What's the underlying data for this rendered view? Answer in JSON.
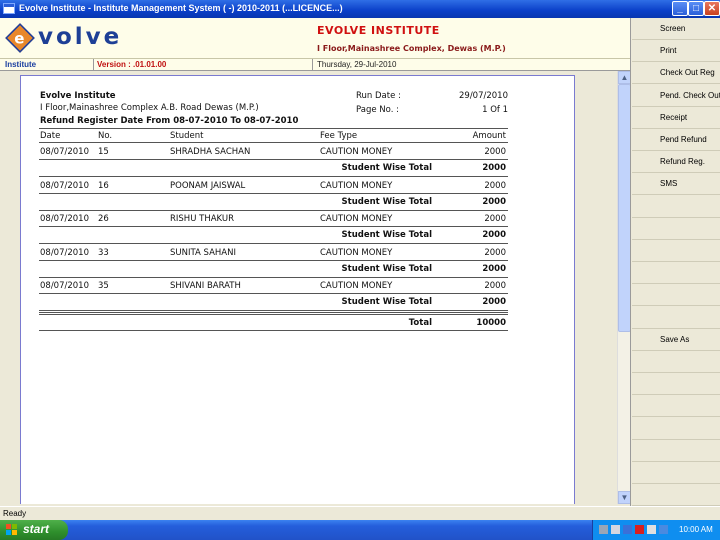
{
  "window": {
    "title": "Evolve Institute - Institute Management System ( -) 2010-2011 (...LICENCE...)",
    "buttons": [
      "_",
      "□",
      "✕"
    ]
  },
  "header": {
    "logo_letter": "e",
    "logo_word": "volve",
    "org_name": "EVOLVE INSTITUTE",
    "org_address": "I Floor,Mainashree Complex, Dewas (M.P.)"
  },
  "status_strip": {
    "module": "Institute",
    "version": "Version : .01.01.00",
    "date": "Thursday, 29-Jul-2010"
  },
  "sidebar": {
    "items": [
      "Screen",
      "Print",
      "Check Out Reg",
      "Pend. Check Out",
      "Receipt",
      "Pend Refund",
      "Refund Reg.",
      "SMS",
      "",
      "",
      "",
      "",
      "",
      "",
      "Save As",
      "",
      "",
      "",
      "",
      "",
      "",
      ""
    ]
  },
  "report": {
    "company": "Evolve Institute",
    "address": "I Floor,Mainashree Complex A.B. Road Dewas (M.P.)",
    "title": "Refund Register Date From 08-07-2010 To 08-07-2010",
    "run_date_label": "Run Date :",
    "run_date": "29/07/2010",
    "page_label": "Page No. :",
    "page": "1 Of 1",
    "columns": [
      "Date",
      "No.",
      "Student",
      "Fee Type",
      "Amount"
    ],
    "rows": [
      {
        "date": "08/07/2010",
        "no": "15",
        "student": "SHRADHA SACHAN",
        "fee": "CAUTION MONEY",
        "amount": "2000",
        "subtotal_label": "Student Wise Total",
        "subtotal": "2000"
      },
      {
        "date": "08/07/2010",
        "no": "16",
        "student": "POONAM JAISWAL",
        "fee": "CAUTION MONEY",
        "amount": "2000",
        "subtotal_label": "Student Wise Total",
        "subtotal": "2000"
      },
      {
        "date": "08/07/2010",
        "no": "26",
        "student": "RISHU  THAKUR",
        "fee": "CAUTION MONEY",
        "amount": "2000",
        "subtotal_label": "Student Wise Total",
        "subtotal": "2000"
      },
      {
        "date": "08/07/2010",
        "no": "33",
        "student": "SUNITA  SAHANI",
        "fee": "CAUTION MONEY",
        "amount": "2000",
        "subtotal_label": "Student Wise Total",
        "subtotal": "2000"
      },
      {
        "date": "08/07/2010",
        "no": "35",
        "student": "SHIVANI  BARATH",
        "fee": "CAUTION MONEY",
        "amount": "2000",
        "subtotal_label": "Student Wise Total",
        "subtotal": "2000"
      }
    ],
    "total_label": "Total",
    "total": "10000"
  },
  "statusbar": {
    "text": "Ready"
  },
  "taskbar": {
    "start_label": "start",
    "clock": "10:00 AM"
  },
  "colors": {
    "title_blue": "#0a3fc8",
    "brand_red": "#d01010",
    "brand_blue": "#1d3f96",
    "logo_orange": "#e8872a"
  }
}
